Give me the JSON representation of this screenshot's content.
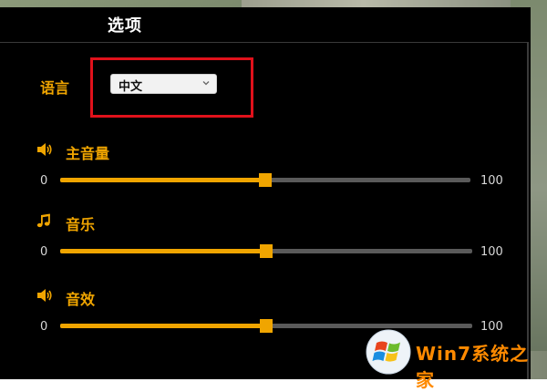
{
  "window": {
    "tab_title": "选项"
  },
  "language": {
    "label": "语言",
    "selected": "中文"
  },
  "sliders": [
    {
      "label": "主音量",
      "icon": "speaker-icon",
      "min_label": "0",
      "max_label": "100",
      "value": 50
    },
    {
      "label": "音乐",
      "icon": "music-note-icon",
      "min_label": "0",
      "max_label": "100",
      "value": 50
    },
    {
      "label": "音效",
      "icon": "speaker-icon",
      "min_label": "0",
      "max_label": "100",
      "value": 50
    }
  ],
  "watermark": {
    "text": "Win7系统之家"
  },
  "colors": {
    "accent": "#f0a500",
    "highlight": "#e0111b",
    "panel": "#000000",
    "track": "#5a5a5a"
  }
}
